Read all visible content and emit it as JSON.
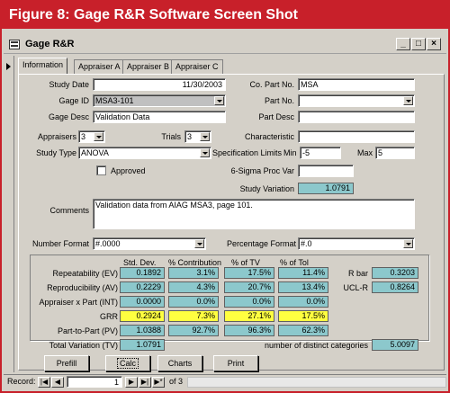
{
  "banner": {
    "title": "Figure 8: Gage R&R Software Screen Shot"
  },
  "window": {
    "title": "Gage R&R",
    "minimize": "_",
    "maximize": "□",
    "close": "×"
  },
  "tabs": [
    {
      "label": "Information",
      "active": true
    },
    {
      "label": "Appraiser A"
    },
    {
      "label": "Appraiser B"
    },
    {
      "label": "Appraiser C"
    }
  ],
  "form": {
    "study_date_label": "Study Date",
    "study_date": "11/30/2003",
    "co_part_no_label": "Co. Part No.",
    "co_part_no": "MSA",
    "gage_id_label": "Gage ID",
    "gage_id": "MSA3-101",
    "part_no_label": "Part No.",
    "part_no": "",
    "gage_desc_label": "Gage Desc",
    "gage_desc": "Validation Data",
    "part_desc_label": "Part Desc",
    "part_desc": "",
    "appraisers_label": "Appraisers",
    "appraisers": "3",
    "trials_label": "Trials",
    "trials": "3",
    "characteristic_label": "Characteristic",
    "characteristic": "",
    "study_type_label": "Study Type",
    "study_type": "ANOVA",
    "spec_limits_label": "Specification Limits",
    "min_label": "Min",
    "min": "-5",
    "max_label": "Max",
    "max": "5",
    "approved_label": "Approved",
    "six_sigma_label": "6-Sigma Proc Var",
    "six_sigma": "",
    "study_variation_label": "Study Variation",
    "study_variation": "1.0791",
    "comments_label": "Comments",
    "comments": "Validation data from AIAG MSA3, page 101.",
    "number_format_label": "Number Format",
    "number_format": "#.0000",
    "percentage_format_label": "Percentage Format",
    "percentage_format": "#.0"
  },
  "results": {
    "headers": [
      "Std. Dev.",
      "% Contribution",
      "% of TV",
      "% of Tol"
    ],
    "rows": [
      {
        "label": "Repeatability (EV)",
        "values": [
          "0.1892",
          "3.1%",
          "17.5%",
          "11.4%"
        ],
        "highlight": false
      },
      {
        "label": "Reproducibility (AV)",
        "values": [
          "0.2229",
          "4.3%",
          "20.7%",
          "13.4%"
        ],
        "highlight": false
      },
      {
        "label": "Appraiser x Part (INT)",
        "values": [
          "0.0000",
          "0.0%",
          "0.0%",
          "0.0%"
        ],
        "highlight": false
      },
      {
        "label": "GRR",
        "values": [
          "0.2924",
          "7.3%",
          "27.1%",
          "17.5%"
        ],
        "highlight": true
      },
      {
        "label": "Part-to-Part (PV)",
        "values": [
          "1.0388",
          "92.7%",
          "96.3%",
          "62.3%"
        ],
        "highlight": false
      }
    ],
    "total_label": "Total Variation (TV)",
    "total": "1.0791",
    "rbar_label": "R bar",
    "rbar": "0.3203",
    "uclr_label": "UCL-R",
    "uclr": "0.8264",
    "ndc_label": "number of distinct categories",
    "ndc": "5.0097"
  },
  "buttons": {
    "prefill": "Prefill",
    "calc": "Calc",
    "charts": "Charts",
    "print": "Print"
  },
  "nav": {
    "record_label": "Record:",
    "current": "1",
    "of_label": "of 3"
  },
  "colors": {
    "banner": "#c8202a",
    "field_teal": "#8cc8cc",
    "field_yellow": "#ffff40",
    "window_bg": "#d4d0c8"
  }
}
